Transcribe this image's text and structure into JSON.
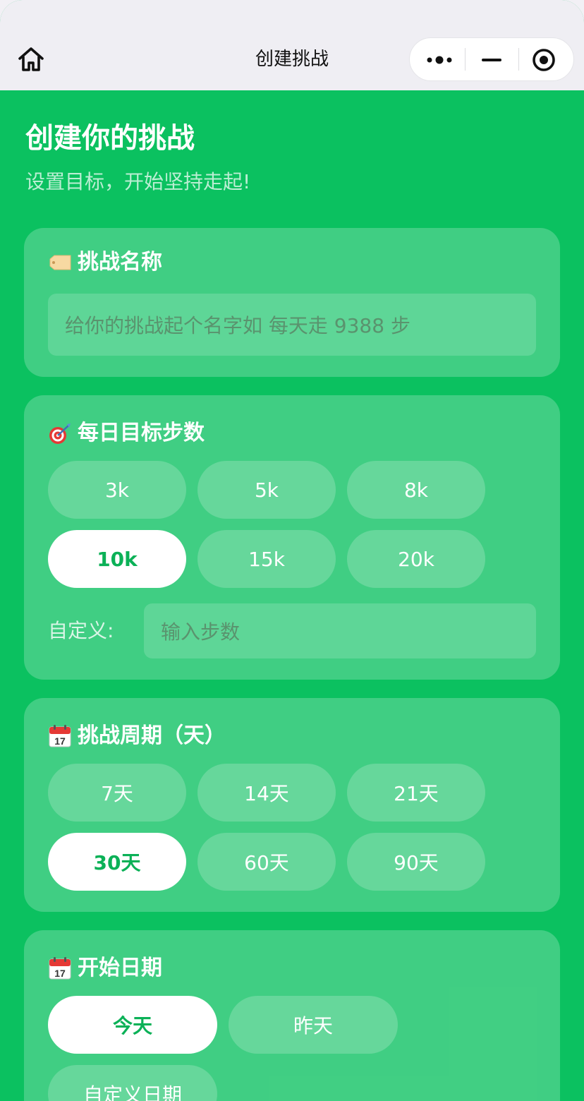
{
  "navbar": {
    "title": "创建挑战"
  },
  "header": {
    "title": "创建你的挑战",
    "subtitle": "设置目标，开始坚持走起!"
  },
  "name_card": {
    "title": "挑战名称",
    "placeholder": "给你的挑战起个名字如 每天走 9388 步"
  },
  "steps_card": {
    "title": "每日目标步数",
    "options": [
      "3k",
      "5k",
      "8k",
      "10k",
      "15k",
      "20k"
    ],
    "selected": "10k",
    "custom_label": "自定义:",
    "custom_placeholder": "输入步数"
  },
  "period_card": {
    "title": "挑战周期（天）",
    "options": [
      "7天",
      "14天",
      "21天",
      "30天",
      "60天",
      "90天"
    ],
    "selected": "30天"
  },
  "start_card": {
    "title": "开始日期",
    "options": [
      "今天",
      "昨天",
      "自定义日期"
    ],
    "selected": "今天"
  },
  "icons": {
    "home": "home-icon",
    "more": "more-dots-icon",
    "minimize": "minimize-icon",
    "close": "target-circle-icon",
    "name": "tag-icon",
    "steps": "dart-target-icon",
    "period": "calendar-icon",
    "start": "calendar-icon"
  },
  "colors": {
    "primary": "#0bc160",
    "selected_text": "#0bb157",
    "navbar_bg": "#efeef3"
  }
}
